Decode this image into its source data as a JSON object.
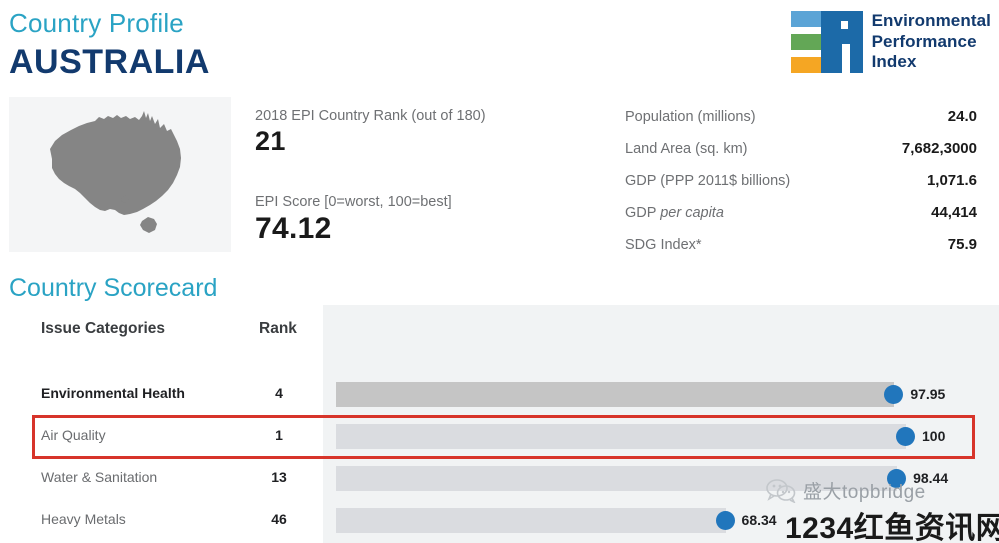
{
  "header": {
    "eyebrow": "Country Profile",
    "country": "AUSTRALIA",
    "logo": {
      "mark_icon": "epi-logo-icon",
      "line1": "Environmental",
      "line2": "Performance",
      "line3": "Index",
      "colors": {
        "bar1": "#5ba4d6",
        "bar2": "#63a756",
        "bar3": "#f5a623",
        "letters": "#1c6aa8",
        "text": "#123a6e"
      }
    },
    "accent_color": "#2aa3c4",
    "country_color": "#123a6e"
  },
  "map": {
    "icon": "australia-map-icon",
    "alt": "Australia",
    "fill": "#858585",
    "bg": "#f4f5f6"
  },
  "key_stats": [
    {
      "label": "2018 EPI Country Rank (out of 180)",
      "value": "21"
    },
    {
      "label": "EPI Score [0=worst, 100=best]",
      "value": "74.12"
    }
  ],
  "country_stats": [
    {
      "label": "Population (millions)",
      "value": "24.0",
      "italic": ""
    },
    {
      "label": "Land Area (sq. km)",
      "value": "7,682,3000",
      "italic": ""
    },
    {
      "label": "GDP (PPP 2011$ billions)",
      "value": "1,071.6",
      "italic": ""
    },
    {
      "label": "GDP ",
      "italic": "per capita",
      "value": "44,414"
    },
    {
      "label": "SDG Index*",
      "value": "75.9",
      "italic": ""
    }
  ],
  "scorecard": {
    "title": "Country Scorecard",
    "col_category": "Issue Categories",
    "col_rank": "Rank",
    "highlight": {
      "row_index": 1,
      "color": "#d7342a"
    },
    "dot_color": "#2176bc"
  },
  "chart_data": {
    "type": "bar",
    "title": "Country Scorecard",
    "xlabel": "",
    "ylabel": "",
    "xlim": [
      0,
      100
    ],
    "grid": false,
    "legend": "none",
    "orientation": "horizontal",
    "categories": [
      "Environmental Health",
      "Air Quality",
      "Water & Sanitation",
      "Heavy Metals"
    ],
    "ranks": [
      4,
      1,
      13,
      46
    ],
    "values": [
      97.95,
      100,
      98.44,
      68.34
    ],
    "value_labels": [
      "97.95",
      "100",
      "98.44",
      "68.34"
    ],
    "is_parent": [
      true,
      false,
      false,
      false
    ],
    "highlighted": [
      false,
      true,
      false,
      false
    ],
    "bar_colors": [
      "#c5c5c5",
      "#dadce0",
      "#dadce0",
      "#dadce0"
    ]
  },
  "watermark": {
    "icon": "wechat-icon",
    "top_text": "盛大topbridge",
    "bottom_text": "1234红鱼资讯网"
  }
}
